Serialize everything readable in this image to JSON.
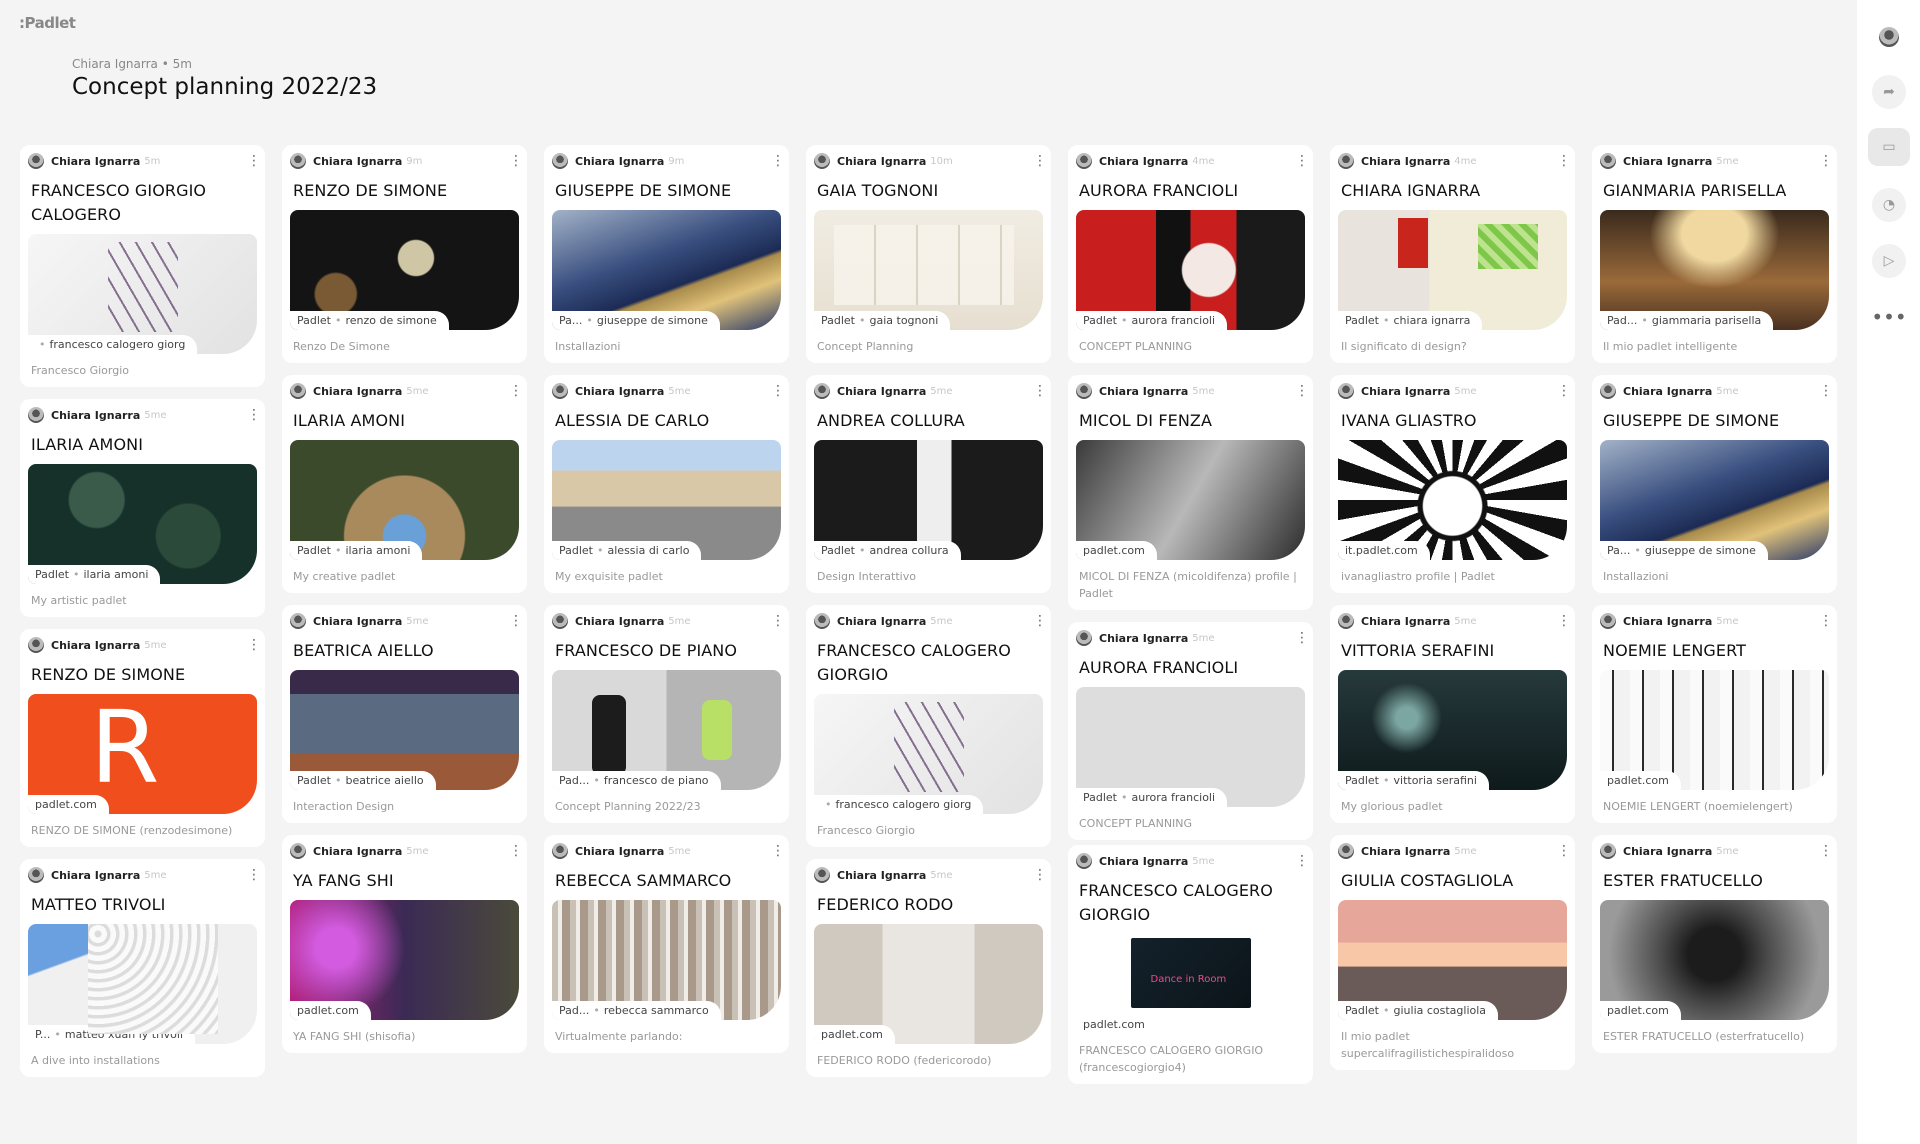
{
  "app": {
    "logo": ":Padlet"
  },
  "board": {
    "author": "Chiara Ignarra",
    "time": "5m",
    "title": "Concept planning 2022/23"
  },
  "sidebar": {
    "icons": [
      "avatar-icon",
      "share-icon",
      "comment-icon",
      "bell-icon",
      "play-icon",
      "more-icon"
    ],
    "more": "•••"
  },
  "columns": [
    {
      "cards": [
        {
          "author": "Chiara Ignarra",
          "time": "5m",
          "name": "FRANCESCO GIORGIO CALOGERO",
          "badge_src": "",
          "badge_owner": "francesco calogero giorg",
          "caption": "Francesco Giorgio"
        },
        {
          "author": "Chiara Ignarra",
          "time": "5me",
          "name": "ILARIA AMONI",
          "badge_src": "Padlet",
          "badge_owner": "ilaria amoni",
          "caption": "My artistic padlet"
        },
        {
          "author": "Chiara Ignarra",
          "time": "5me",
          "name": "RENZO DE SIMONE",
          "badge_src": "padlet.com",
          "badge_owner": "",
          "caption": "RENZO DE SIMONE (renzodesimone)"
        },
        {
          "author": "Chiara Ignarra",
          "time": "5me",
          "name": "MATTEO TRIVOLI",
          "badge_src": "P...",
          "badge_owner": "matteo xuan ly trivoli",
          "caption": "A dive into installations"
        }
      ]
    },
    {
      "cards": [
        {
          "author": "Chiara Ignarra",
          "time": "9m",
          "name": "RENZO DE SIMONE",
          "badge_src": "Padlet",
          "badge_owner": "renzo de simone",
          "caption": "Renzo De Simone"
        },
        {
          "author": "Chiara Ignarra",
          "time": "5me",
          "name": "ILARIA AMONI",
          "badge_src": "Padlet",
          "badge_owner": "ilaria amoni",
          "caption": "My creative padlet"
        },
        {
          "author": "Chiara Ignarra",
          "time": "5me",
          "name": "BEATRICA AIELLO",
          "badge_src": "Padlet",
          "badge_owner": "beatrice aiello",
          "caption": "Interaction Design"
        },
        {
          "author": "Chiara Ignarra",
          "time": "5me",
          "name": "YA FANG SHI",
          "badge_src": "padlet.com",
          "badge_owner": "",
          "caption": "YA FANG SHI (shisofia)"
        }
      ]
    },
    {
      "cards": [
        {
          "author": "Chiara Ignarra",
          "time": "9m",
          "name": "GIUSEPPE DE SIMONE",
          "badge_src": "Pa...",
          "badge_owner": "giuseppe de simone",
          "caption": "Installazioni"
        },
        {
          "author": "Chiara Ignarra",
          "time": "5me",
          "name": "ALESSIA DE CARLO",
          "badge_src": "Padlet",
          "badge_owner": "alessia di carlo",
          "caption": "My exquisite padlet"
        },
        {
          "author": "Chiara Ignarra",
          "time": "5me",
          "name": "FRANCESCO DE PIANO",
          "badge_src": "Pad...",
          "badge_owner": "francesco de piano",
          "caption": "Concept Planning 2022/23"
        },
        {
          "author": "Chiara Ignarra",
          "time": "5me",
          "name": "REBECCA SAMMARCO",
          "badge_src": "Pad...",
          "badge_owner": "rebecca sammarco",
          "caption": "Virtualmente parlando:"
        }
      ]
    },
    {
      "cards": [
        {
          "author": "Chiara Ignarra",
          "time": "10m",
          "name": "GAIA TOGNONI",
          "badge_src": "Padlet",
          "badge_owner": "gaia tognoni",
          "caption": "Concept Planning"
        },
        {
          "author": "Chiara Ignarra",
          "time": "5me",
          "name": "ANDREA COLLURA",
          "badge_src": "Padlet",
          "badge_owner": "andrea collura",
          "caption": "Design Interattivo"
        },
        {
          "author": "Chiara Ignarra",
          "time": "5me",
          "name": "FRANCESCO CALOGERO GIORGIO",
          "badge_src": "",
          "badge_owner": "francesco calogero giorg",
          "caption": "Francesco Giorgio"
        },
        {
          "author": "Chiara Ignarra",
          "time": "5me",
          "name": "FEDERICO RODO",
          "badge_src": "padlet.com",
          "badge_owner": "",
          "caption": "FEDERICO RODO (federicorodo)"
        }
      ]
    },
    {
      "cards": [
        {
          "author": "Chiara Ignarra",
          "time": "4me",
          "name": "AURORA FRANCIOLI",
          "badge_src": "Padlet",
          "badge_owner": "aurora francioli",
          "caption": "CONCEPT PLANNING"
        },
        {
          "author": "Chiara Ignarra",
          "time": "5me",
          "name": "MICOL DI FENZA",
          "badge_src": "padlet.com",
          "badge_owner": "",
          "caption": "MICOL DI FENZA (micoldifenza) profile | Padlet"
        },
        {
          "author": "Chiara Ignarra",
          "time": "5me",
          "name": "AURORA FRANCIOLI",
          "badge_src": "Padlet",
          "badge_owner": "aurora francioli",
          "caption": "CONCEPT PLANNING"
        },
        {
          "author": "Chiara Ignarra",
          "time": "5me",
          "name": "FRANCESCO CALOGERO GIORGIO",
          "badge_src": "padlet.com",
          "badge_owner": "",
          "caption": "FRANCESCO CALOGERO GIORGIO (francescogiorgio4)",
          "film_text": "Dance in Room"
        }
      ]
    },
    {
      "cards": [
        {
          "author": "Chiara Ignarra",
          "time": "4me",
          "name": "CHIARA IGNARRA",
          "badge_src": "Padlet",
          "badge_owner": "chiara ignarra",
          "caption": "Il significato di design?"
        },
        {
          "author": "Chiara Ignarra",
          "time": "5me",
          "name": "IVANA GLIASTRO",
          "badge_src": "it.padlet.com",
          "badge_owner": "",
          "caption": "ivanagliastro profile | Padlet"
        },
        {
          "author": "Chiara Ignarra",
          "time": "5me",
          "name": "VITTORIA SERAFINI",
          "badge_src": "Padlet",
          "badge_owner": "vittoria serafini",
          "caption": "My glorious padlet"
        },
        {
          "author": "Chiara Ignarra",
          "time": "5me",
          "name": "GIULIA COSTAGLIOLA",
          "badge_src": "Padlet",
          "badge_owner": "giulia costagliola",
          "caption": "Il mio padlet supercalifragilistichespiralidoso"
        }
      ]
    },
    {
      "cards": [
        {
          "author": "Chiara Ignarra",
          "time": "5me",
          "name": "GIANMARIA PARISELLA",
          "badge_src": "Pad...",
          "badge_owner": "giammaria parisella",
          "caption": "Il mio padlet intelligente"
        },
        {
          "author": "Chiara Ignarra",
          "time": "5me",
          "name": "GIUSEPPE DE SIMONE",
          "badge_src": "Pa...",
          "badge_owner": "giuseppe de simone",
          "caption": "Installazioni"
        },
        {
          "author": "Chiara Ignarra",
          "time": "5me",
          "name": "NOEMIE LENGERT",
          "badge_src": "padlet.com",
          "badge_owner": "",
          "caption": "NOEMIE LENGERT (noemielengert)"
        },
        {
          "author": "Chiara Ignarra",
          "time": "5me",
          "name": "ESTER FRATUCELLO",
          "badge_src": "padlet.com",
          "badge_owner": "",
          "caption": "ESTER FRATUCELLO (esterfratucello)"
        }
      ]
    }
  ],
  "r_letter": "R"
}
